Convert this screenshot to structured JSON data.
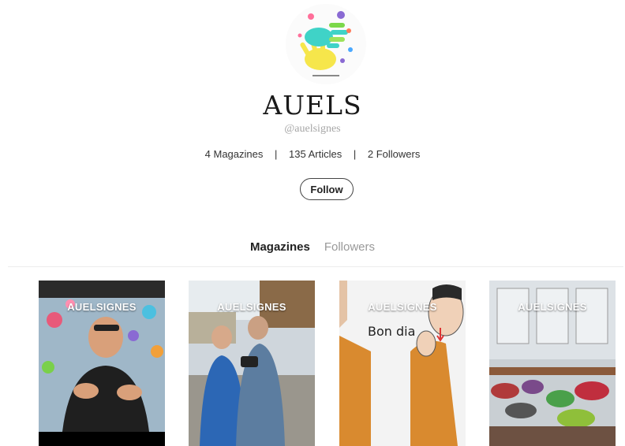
{
  "profile": {
    "name": "AUELS",
    "handle": "@auelsignes",
    "stats": {
      "magazines": "4 Magazines",
      "articles": "135 Articles",
      "followers": "2 Followers",
      "separator": "|"
    },
    "follow_label": "Follow",
    "avatar_icon": "hands-logo-icon"
  },
  "tabs": [
    {
      "label": "Magazines",
      "active": true
    },
    {
      "label": "Followers",
      "active": false
    }
  ],
  "magazines": [
    {
      "label": "AUELSIGNES",
      "caption": ""
    },
    {
      "label": "AUELSIGNES",
      "caption": ""
    },
    {
      "label": "AUELSIGNES",
      "caption": "Bon dia"
    },
    {
      "label": "AUELSIGNES",
      "caption": ""
    }
  ]
}
